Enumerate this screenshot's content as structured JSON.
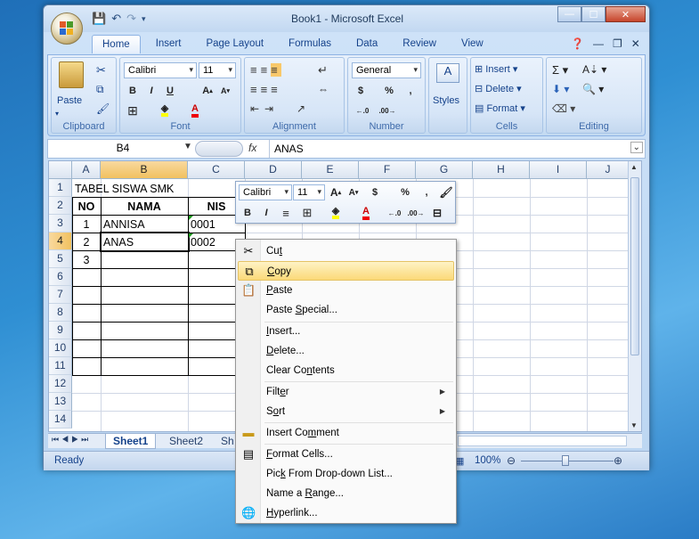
{
  "window": {
    "title": "Book1 - Microsoft Excel",
    "minimize": "—",
    "maximize": "☐",
    "close": "✕"
  },
  "tabs": [
    "Home",
    "Insert",
    "Page Layout",
    "Formulas",
    "Data",
    "Review",
    "View"
  ],
  "ribbon": {
    "clipboard": {
      "label": "Clipboard",
      "paste": "Paste"
    },
    "font": {
      "label": "Font",
      "name": "Calibri",
      "size": "11",
      "bold": "B",
      "italic": "I",
      "underline": "U"
    },
    "alignment": {
      "label": "Alignment"
    },
    "number": {
      "label": "Number",
      "format": "General",
      "currency": "$",
      "percent": "%",
      "comma": ","
    },
    "styles": {
      "label": "Styles"
    },
    "cells": {
      "label": "Cells",
      "insert": "Insert",
      "delete": "Delete",
      "format": "Format"
    },
    "editing": {
      "label": "Editing"
    }
  },
  "formula_bar": {
    "name_box": "B4",
    "fx": "fx",
    "value": "ANAS"
  },
  "columns": [
    "A",
    "B",
    "C",
    "D",
    "E",
    "F",
    "G",
    "H",
    "I",
    "J"
  ],
  "rows": [
    "1",
    "2",
    "3",
    "4",
    "5",
    "6",
    "7",
    "8",
    "9",
    "10",
    "11",
    "12",
    "13",
    "14"
  ],
  "cells": {
    "b1": "TABEL SISWA SMK",
    "a2": "NO",
    "b2": "NAMA",
    "c2": "NIS",
    "a3": "1",
    "b3": "ANNISA",
    "c3": "0001",
    "a4": "2",
    "b4": "ANAS",
    "c4": "0002",
    "a5": "3"
  },
  "sheet_tabs": [
    "Sheet1",
    "Sheet2",
    "Sh"
  ],
  "status": {
    "left": "Ready",
    "zoom": "100%"
  },
  "mini_toolbar": {
    "font": "Calibri",
    "size": "11",
    "bold": "B",
    "italic": "I",
    "currency": "$",
    "percent": "%",
    "comma": ","
  },
  "context_menu": {
    "cut": {
      "pre": "Cu",
      "u": "t",
      "post": ""
    },
    "copy": {
      "pre": "",
      "u": "C",
      "post": "opy"
    },
    "paste": {
      "pre": "",
      "u": "P",
      "post": "aste"
    },
    "paste_special": {
      "pre": "Paste ",
      "u": "S",
      "post": "pecial..."
    },
    "insert": {
      "pre": "",
      "u": "I",
      "post": "nsert..."
    },
    "delete": {
      "pre": "",
      "u": "D",
      "post": "elete..."
    },
    "clear": {
      "pre": "Clear Co",
      "u": "n",
      "post": "tents"
    },
    "filter": {
      "pre": "Filt",
      "u": "e",
      "post": "r"
    },
    "sort": {
      "pre": "S",
      "u": "o",
      "post": "rt"
    },
    "insert_comment": {
      "pre": "Insert Co",
      "u": "m",
      "post": "ment"
    },
    "format_cells": {
      "pre": "",
      "u": "F",
      "post": "ormat Cells..."
    },
    "pick": {
      "pre": "Pic",
      "u": "k",
      "post": " From Drop-down List..."
    },
    "name_range": {
      "pre": "Name a ",
      "u": "R",
      "post": "ange..."
    },
    "hyperlink": {
      "pre": "",
      "u": "H",
      "post": "yperlink..."
    }
  }
}
